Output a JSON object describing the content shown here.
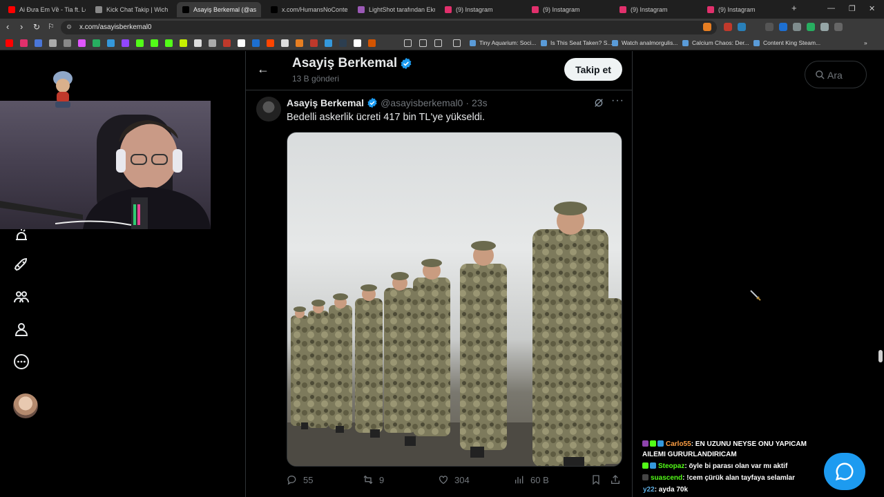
{
  "browser": {
    "tabs": [
      {
        "title": "Ai Đưa Em Về - Tia ft. Lê T",
        "color": "#ff0000"
      },
      {
        "title": "Kick Chat Takip | Wich",
        "color": "#888888"
      },
      {
        "title": "Asayiş Berkemal (@as",
        "color": "#000000",
        "active": true
      },
      {
        "title": "x.com/HumansNoContext",
        "color": "#000000"
      },
      {
        "title": "LightShot tarafından Ekran",
        "color": "#9b59b6"
      },
      {
        "title": "(9) Instagram",
        "color": "#e1306c"
      },
      {
        "title": "(9) Instagram",
        "color": "#e1306c"
      },
      {
        "title": "(9) Instagram",
        "color": "#e1306c"
      },
      {
        "title": "(9) Instagram",
        "color": "#e1306c"
      }
    ],
    "new_tab": "+",
    "window_controls": {
      "minimize": "—",
      "maximize": "❐",
      "close": "✕"
    },
    "url": "x.com/asayisberkemal0",
    "bookmarks": [
      {
        "label": "Tiny Aquarium: Soci..."
      },
      {
        "label": "Is This Seat Taken? S..."
      },
      {
        "label": "Watch analmorgulis..."
      },
      {
        "label": "Calcium Chaos: Der..."
      },
      {
        "label": "Content King Steam..."
      }
    ],
    "bookmarks_more": "»"
  },
  "profile": {
    "name": "Asayiş Berkemal",
    "post_count": "13 B gönderi",
    "follow_label": "Takip et"
  },
  "search": {
    "placeholder": "Ara"
  },
  "tweet": {
    "name": "Asayiş Berkemal",
    "handle": "@asayisberkemal0",
    "dot": "·",
    "time": "23s",
    "text": "Bedelli askerlik ücreti 417 bin TL'ye yükseldi.",
    "stats": {
      "replies": "55",
      "reposts": "9",
      "likes": "304",
      "views": "60 B"
    }
  },
  "chat": [
    {
      "user": "Carlo55",
      "user_color": "#ff9f43",
      "text": ": EN UZUNU NEYSE ONU YAPICAM AILEMI GURURLANDIRICAM",
      "badges": [
        "#8e44ad",
        "#53fc18",
        "#3498db"
      ]
    },
    {
      "user": "Steopaz",
      "user_color": "#53fc18",
      "text": ": öyle bi parası olan var mı aktif",
      "badges": [
        "#53fc18",
        "#3498db"
      ]
    },
    {
      "user": "suascend",
      "user_color": "#53fc18",
      "text": ": !cem çürük alan tayfaya selamlar",
      "badges": [
        "#444444"
      ]
    },
    {
      "user": "y22",
      "user_color": "#5dade2",
      "text": ": ayda 70k",
      "badges": []
    }
  ]
}
